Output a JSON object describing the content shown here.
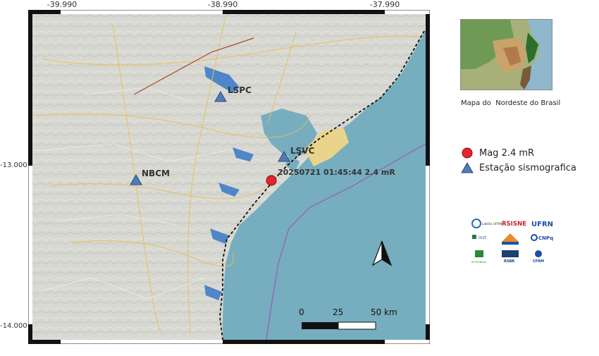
{
  "axes": {
    "top_ticks": [
      "-39.990",
      "-38.990",
      "-37.990"
    ],
    "left_ticks": [
      "-13.000",
      "-14.000"
    ]
  },
  "map": {
    "land_color": "#d9d9d4",
    "sea_color": "#76aebf",
    "stations": [
      {
        "code": "LSPC"
      },
      {
        "code": "LSVC"
      },
      {
        "code": "NBCM"
      }
    ],
    "event": {
      "label": "20250721 01:45:44 2.4 mR",
      "color": "#e8232b"
    },
    "scale_bar": {
      "labels": [
        "0",
        "25",
        "50 km"
      ]
    },
    "north_arrow": "north-arrow"
  },
  "inset": {
    "caption": "Mapa do  Nordeste do Brasil"
  },
  "legend": {
    "event_label": "Mag 2.4 mR",
    "station_label": "Estação sismografica",
    "event_color": "#e8232b",
    "station_color": "#4f7bb8"
  },
  "logos": {
    "labsis": "LabSis UFRN",
    "rsisne": "RSISNE",
    "ufrn": "UFRN",
    "inct": "inct",
    "cnpq": "CNPq",
    "petrobras": "PETROBRAS",
    "rsbr": "RSBR",
    "cprm": "CPRM"
  }
}
